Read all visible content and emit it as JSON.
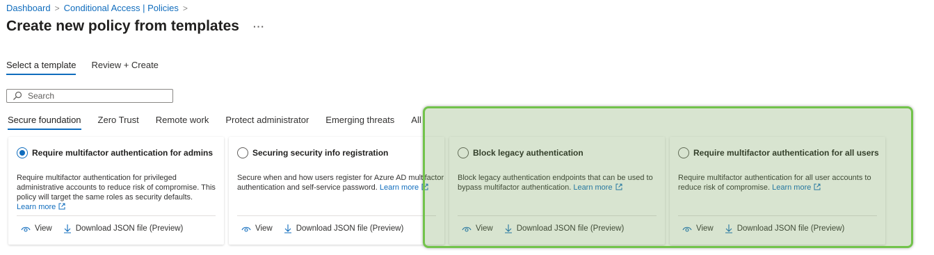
{
  "breadcrumb": {
    "items": [
      "Dashboard",
      "Conditional Access | Policies"
    ],
    "separator": ">"
  },
  "page": {
    "title": "Create new policy from templates",
    "more_label": "···"
  },
  "wizard_tabs": [
    {
      "label": "Select a template",
      "active": true
    },
    {
      "label": "Review + Create",
      "active": false
    }
  ],
  "search": {
    "placeholder": "Search"
  },
  "category_tabs": [
    {
      "label": "Secure foundation",
      "active": true
    },
    {
      "label": "Zero Trust",
      "active": false
    },
    {
      "label": "Remote work",
      "active": false
    },
    {
      "label": "Protect administrator",
      "active": false
    },
    {
      "label": "Emerging threats",
      "active": false
    },
    {
      "label": "All",
      "active": false
    }
  ],
  "cards": [
    {
      "title": "Require multifactor authentication for admins",
      "selected": true,
      "description": "Require multifactor authentication for privileged administrative accounts to reduce risk of compromise. This policy will target the same roles as security defaults.",
      "learn_more": "Learn more",
      "view_label": "View",
      "download_label": "Download JSON file (Preview)"
    },
    {
      "title": "Securing security info registration",
      "selected": false,
      "description": "Secure when and how users register for Azure AD multifactor authentication and self-service password.",
      "learn_more": "Learn more",
      "view_label": "View",
      "download_label": "Download JSON file (Preview)"
    },
    {
      "title": "Block legacy authentication",
      "selected": false,
      "description": "Block legacy authentication endpoints that can be used to bypass multifactor authentication.",
      "learn_more": "Learn more",
      "view_label": "View",
      "download_label": "Download JSON file (Preview)"
    },
    {
      "title": "Require multifactor authentication for all users",
      "selected": false,
      "description": "Require multifactor authentication for all user accounts to reduce risk of compromise.",
      "learn_more": "Learn more",
      "view_label": "View",
      "download_label": "Download JSON file (Preview)"
    }
  ],
  "colors": {
    "accent": "#0f6cbd",
    "highlight_border": "#72c34b"
  }
}
